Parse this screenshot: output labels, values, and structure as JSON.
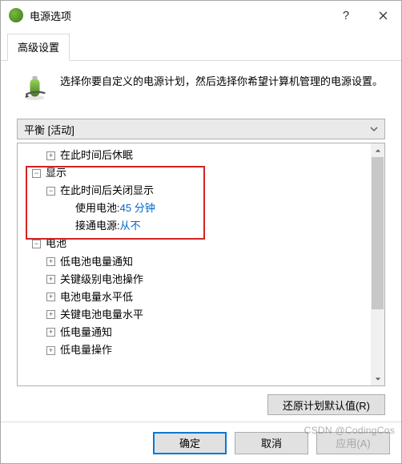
{
  "window": {
    "title": "电源选项"
  },
  "tabs": {
    "advanced": "高级设置"
  },
  "intro": {
    "text": "选择你要自定义的电源计划，然后选择你希望计算机管理的电源设置。"
  },
  "plan": {
    "selected": "平衡 [活动]"
  },
  "tree": {
    "sleep_after": "在此时间后休眠",
    "display": "显示",
    "display_off_after": "在此时间后关闭显示",
    "on_battery_label": "使用电池: ",
    "on_battery_value": "45 分钟",
    "plugged_label": "接通电源: ",
    "plugged_value": "从不",
    "battery": "电池",
    "low_notify": "低电池电量通知",
    "crit_action": "关键级别电池操作",
    "low_level": "电池电量水平低",
    "crit_level": "关键电池电量水平",
    "low_notify2": "低电量通知",
    "low_action": "低电量操作"
  },
  "buttons": {
    "restore": "还原计划默认值(R)",
    "ok": "确定",
    "cancel": "取消",
    "apply": "应用(A)"
  },
  "watermark": "CSDN @CodingCos"
}
